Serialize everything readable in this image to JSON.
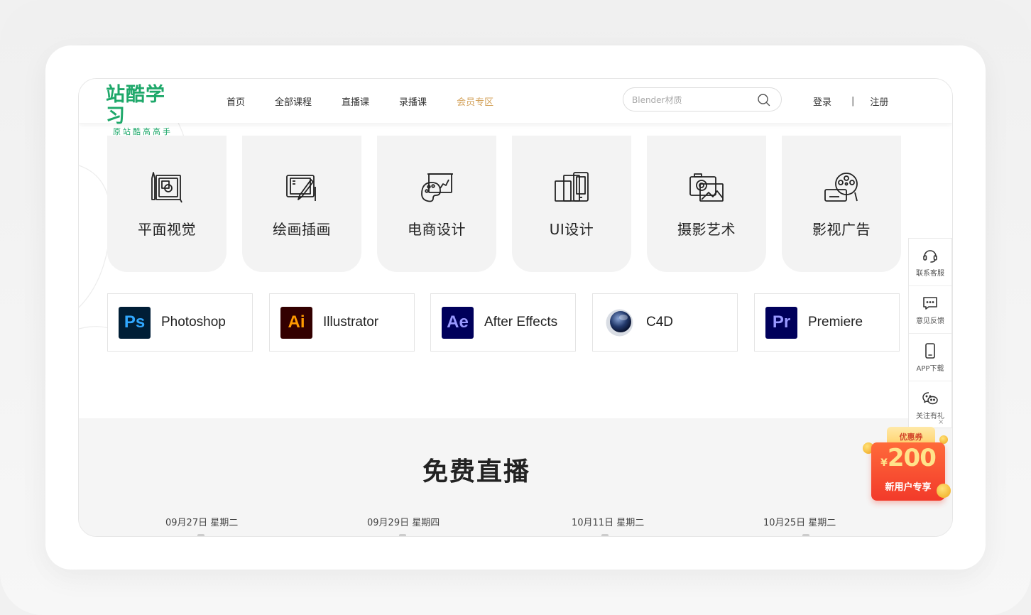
{
  "logo": {
    "main": "站酷学习",
    "sub": "原站酷高高手"
  },
  "nav": [
    {
      "label": "首页"
    },
    {
      "label": "全部课程"
    },
    {
      "label": "直播课"
    },
    {
      "label": "录播课"
    },
    {
      "label": "会员专区"
    }
  ],
  "search": {
    "placeholder": "Blender材质"
  },
  "auth": {
    "login": "登录",
    "separator": "|",
    "register": "注册"
  },
  "categories": [
    {
      "label": "平面视觉",
      "icon": "graphic-design-icon"
    },
    {
      "label": "绘画插画",
      "icon": "illustration-icon"
    },
    {
      "label": "电商设计",
      "icon": "ecommerce-icon"
    },
    {
      "label": "UI设计",
      "icon": "ui-design-icon"
    },
    {
      "label": "摄影艺术",
      "icon": "photography-icon"
    },
    {
      "label": "影视广告",
      "icon": "film-ad-icon"
    }
  ],
  "software": [
    {
      "abbr": "Ps",
      "name": "Photoshop",
      "bg": "#001e36",
      "fg": "#31a8ff"
    },
    {
      "abbr": "Ai",
      "name": "Illustrator",
      "bg": "#330000",
      "fg": "#ff9a00"
    },
    {
      "abbr": "Ae",
      "name": "After Effects",
      "bg": "#00005b",
      "fg": "#9999ff"
    },
    {
      "abbr": "",
      "name": "C4D",
      "bg": "#1a2b4f",
      "fg": "#ffffff"
    },
    {
      "abbr": "Pr",
      "name": "Premiere",
      "bg": "#00005b",
      "fg": "#9999ff"
    }
  ],
  "live": {
    "title": "免费直播",
    "dates": [
      "09月27日 星期二",
      "09月29日 星期四",
      "10月11日 星期二",
      "10月25日 星期二"
    ]
  },
  "sidebar": [
    {
      "label": "联系客服",
      "icon": "headset-icon"
    },
    {
      "label": "意见反馈",
      "icon": "feedback-icon"
    },
    {
      "label": "APP下载",
      "icon": "phone-icon"
    },
    {
      "label": "关注有礼",
      "icon": "wechat-icon"
    }
  ],
  "coupon": {
    "title": "优惠券",
    "currency": "¥",
    "amount": "200",
    "text": "新用户专享",
    "close": "×"
  },
  "colors": {
    "brand": "#1ea86a",
    "vip": "#d4a35c",
    "coupon": "#f23a2a"
  }
}
